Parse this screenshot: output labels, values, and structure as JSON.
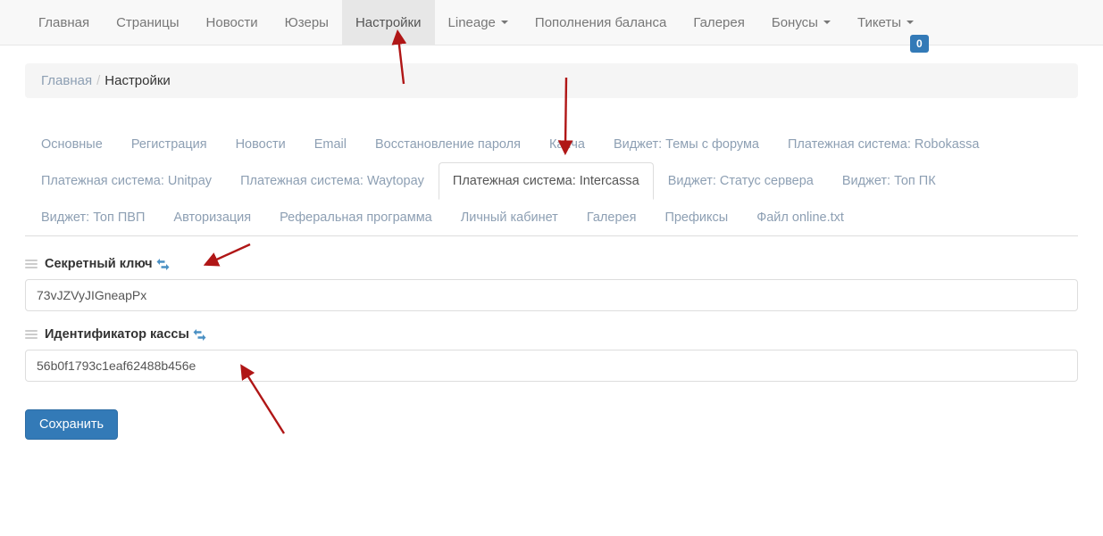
{
  "navbar": {
    "items": [
      {
        "label": "Главная",
        "active": false,
        "caret": false
      },
      {
        "label": "Страницы",
        "active": false,
        "caret": false
      },
      {
        "label": "Новости",
        "active": false,
        "caret": false
      },
      {
        "label": "Юзеры",
        "active": false,
        "caret": false
      },
      {
        "label": "Настройки",
        "active": true,
        "caret": false
      },
      {
        "label": "Lineage",
        "active": false,
        "caret": true
      },
      {
        "label": "Пополнения баланса",
        "active": false,
        "caret": false
      },
      {
        "label": "Галерея",
        "active": false,
        "caret": false
      },
      {
        "label": "Бонусы",
        "active": false,
        "caret": true
      },
      {
        "label": "Тикеты",
        "active": false,
        "caret": true
      }
    ],
    "badge": "0",
    "badge_color": "#337ab7",
    "active_bg": "#e7e7e7"
  },
  "breadcrumb": {
    "home": "Главная",
    "separator": "/",
    "current": "Настройки"
  },
  "tabs": [
    {
      "label": "Основные",
      "active": false
    },
    {
      "label": "Регистрация",
      "active": false
    },
    {
      "label": "Новости",
      "active": false
    },
    {
      "label": "Email",
      "active": false
    },
    {
      "label": "Восстановление пароля",
      "active": false
    },
    {
      "label": "Капча",
      "active": false
    },
    {
      "label": "Виджет: Темы с форума",
      "active": false
    },
    {
      "label": "Платежная система: Robokassa",
      "active": false
    },
    {
      "label": "Платежная система: Unitpay",
      "active": false
    },
    {
      "label": "Платежная система: Waytopay",
      "active": false
    },
    {
      "label": "Платежная система: Intercassa",
      "active": true
    },
    {
      "label": "Виджет: Статус сервера",
      "active": false
    },
    {
      "label": "Виджет: Топ ПК",
      "active": false
    },
    {
      "label": "Виджет: Топ ПВП",
      "active": false
    },
    {
      "label": "Авторизация",
      "active": false
    },
    {
      "label": "Реферальная программа",
      "active": false
    },
    {
      "label": "Личный кабинет",
      "active": false
    },
    {
      "label": "Галерея",
      "active": false
    },
    {
      "label": "Префиксы",
      "active": false
    },
    {
      "label": "Файл online.txt",
      "active": false
    }
  ],
  "form": {
    "fields": [
      {
        "label": "Секретный ключ",
        "value": "73vJZVyJIGneapPx",
        "placeholder": ""
      },
      {
        "label": "Идентификатор кассы",
        "value": "56b0f1793c1eaf62488b456e",
        "placeholder": ""
      }
    ],
    "save_label": "Сохранить",
    "link_color": "#4a90c4",
    "button_color": "#337ab7"
  },
  "annotations": {
    "color": "#b01616",
    "arrows": [
      {
        "name": "arrow-to-settings-menu",
        "points_to": "Настройки"
      },
      {
        "name": "arrow-to-intercassa-tab",
        "points_to": "Платежная система: Intercassa"
      },
      {
        "name": "arrow-to-secret-key-label",
        "points_to": "Секретный ключ"
      },
      {
        "name": "arrow-to-cashbox-id-input",
        "points_to": "56b0f1793c1eaf62488b456e"
      }
    ]
  }
}
